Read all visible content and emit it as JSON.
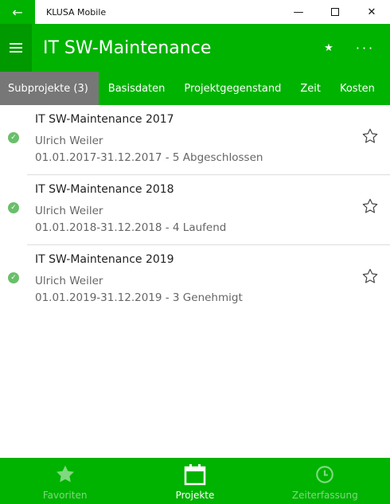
{
  "window": {
    "back_icon": "arrow-left-icon",
    "title": "KLUSA Mobile",
    "controls": [
      "minimize-icon",
      "maximize-icon",
      "close-icon"
    ]
  },
  "header": {
    "menu_icon": "hamburger-icon",
    "title": "IT SW-Maintenance",
    "favorite_icon": "star-icon",
    "more_icon": "more-icon"
  },
  "tabs": [
    {
      "label": "Subprojekte (3)",
      "active": true
    },
    {
      "label": "Basisdaten"
    },
    {
      "label": "Projektgegenstand"
    },
    {
      "label": "Zeit"
    },
    {
      "label": "Kosten"
    }
  ],
  "projects": [
    {
      "name": "IT SW-Maintenance 2017",
      "owner": "Ulrich Weiler",
      "dates": "01.01.2017-31.12.2017 - 5 Abgeschlossen"
    },
    {
      "name": "IT SW-Maintenance 2018",
      "owner": "Ulrich Weiler",
      "dates": "01.01.2018-31.12.2018 - 4 Laufend"
    },
    {
      "name": "IT SW-Maintenance 2019",
      "owner": "Ulrich Weiler",
      "dates": "01.01.2019-31.12.2019 - 3 Genehmigt"
    }
  ],
  "bottom_nav": [
    {
      "label": "Favoriten",
      "icon": "star-icon"
    },
    {
      "label": "Projekte",
      "icon": "calendar-icon",
      "active": true
    },
    {
      "label": "Zeiterfassung",
      "icon": "clock-icon"
    }
  ],
  "colors": {
    "accent": "#00b300",
    "active_tab": "#777777",
    "status_ok": "#6abf6a"
  }
}
